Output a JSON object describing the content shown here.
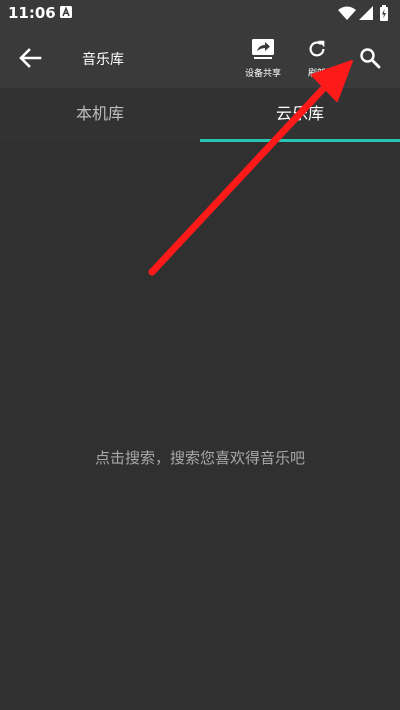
{
  "status_bar": {
    "time": "11:06",
    "icons": [
      "notification-a-icon",
      "wifi-icon",
      "signal-icon",
      "battery-icon"
    ]
  },
  "app_bar": {
    "title": "音乐库",
    "actions": {
      "share": {
        "label": "设备共享",
        "icon": "device-share-icon"
      },
      "refresh": {
        "label": "刷新",
        "icon": "refresh-icon"
      },
      "search": {
        "icon": "search-icon"
      }
    }
  },
  "tabs": [
    {
      "label": "本机库",
      "selected": false
    },
    {
      "label": "云乐库",
      "selected": true
    }
  ],
  "empty_state": {
    "message": "点击搜索，搜索您喜欢得音乐吧"
  },
  "colors": {
    "background": "#303030",
    "app_bar": "#3a3a3a",
    "tab_indicator": "#26c6b0",
    "annotation_arrow": "#ff1a1a",
    "muted_text": "#a8a8a8"
  }
}
